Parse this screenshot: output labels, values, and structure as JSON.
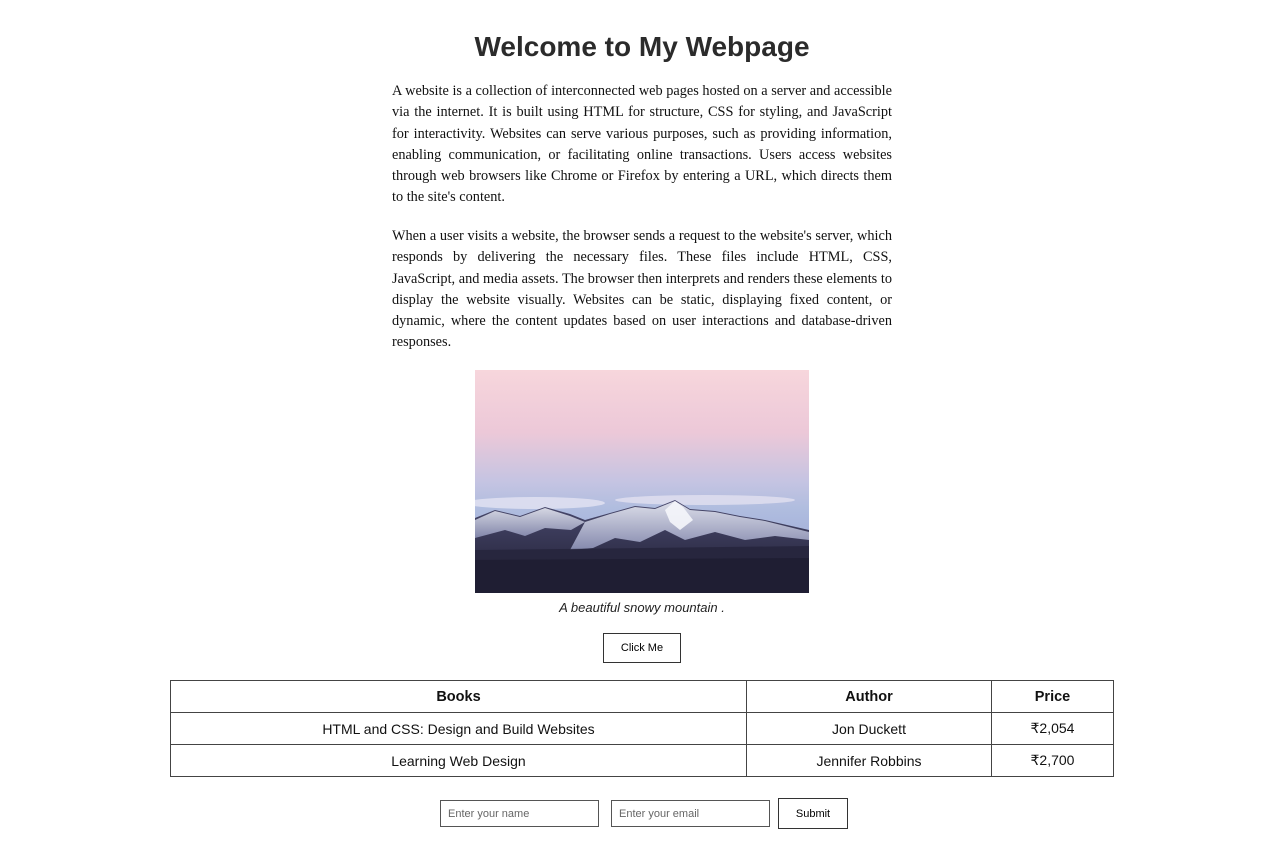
{
  "page": {
    "title": "Welcome to My Webpage"
  },
  "content": {
    "paragraphs": [
      "A website is a collection of interconnected web pages hosted on a server and accessible via the internet. It is built using HTML for structure, CSS for styling, and JavaScript for interactivity. Websites can serve various purposes, such as providing information, enabling communication, or facilitating online transactions. Users access websites through web browsers like Chrome or Firefox by entering a URL, which directs them to the site's content.",
      "When a user visits a website, the browser sends a request to the website's server, which responds by delivering the necessary files. These files include HTML, CSS, JavaScript, and media assets. The browser then interprets and renders these elements to display the website visually. Websites can be static, displaying fixed content, or dynamic, where the content updates based on user interactions and database-driven responses."
    ],
    "image_caption": "A beautiful snowy mountain ."
  },
  "actions": {
    "click_label": "Click Me",
    "submit_label": "Submit"
  },
  "table": {
    "headers": [
      "Books",
      "Author",
      "Price"
    ],
    "rows": [
      [
        "HTML and CSS: Design and Build Websites",
        "Jon Duckett",
        "₹2,054"
      ],
      [
        "Learning Web Design",
        "Jennifer Robbins",
        "₹2,700"
      ]
    ]
  },
  "form": {
    "name_placeholder": "Enter your name",
    "email_placeholder": "Enter your email",
    "name_value": "",
    "email_value": ""
  },
  "colors": {
    "title": "#2b2b2b",
    "border": "#444444",
    "background": "#ffffff"
  }
}
